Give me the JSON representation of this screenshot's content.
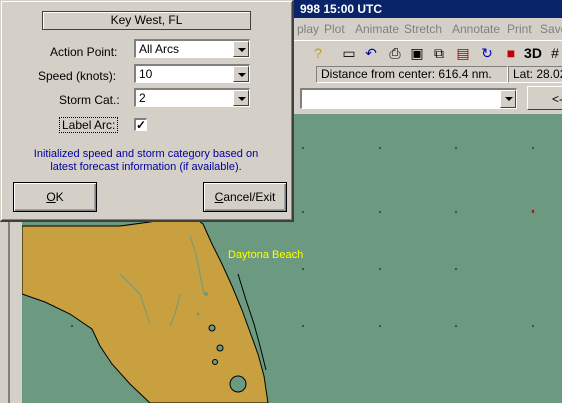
{
  "app": {
    "title_fragment": "998 15:00 UTC",
    "menus": [
      "play",
      "Plot",
      "Animate",
      "Stretch",
      "Annotate",
      "Print",
      "Save"
    ],
    "status": {
      "distance": "Distance from center: 616.4 nm.",
      "lat": "Lat: 28.02"
    },
    "nav_button": "<-",
    "map_label": "Daytona Beach",
    "colors": {
      "ocean": "#6b9a80",
      "land": "#c8a040",
      "label": "#ffff00",
      "titlebar": "#0a246a"
    }
  },
  "toolbar_icons": [
    "question-icon",
    "card-icon",
    "undo-icon",
    "printer-icon",
    "save-icon",
    "copy-icon",
    "note-icon",
    "refresh-icon",
    "stop-icon",
    "3d-icon",
    "hash-icon"
  ],
  "dialog": {
    "location": "Key West, FL",
    "fields": [
      {
        "label": "Action Point:",
        "value": "All Arcs"
      },
      {
        "label": "Speed (knots):",
        "value": "10"
      },
      {
        "label": "Storm Cat.:",
        "value": "2"
      }
    ],
    "label_arc": {
      "label": "Label Arc:",
      "checked": true,
      "mark": "✓"
    },
    "info": "Initialized speed and storm category based on latest forecast information (if available).",
    "ok_underlined": "O",
    "ok_rest": "K",
    "cancel_underlined": "C",
    "cancel_rest": "ancel/Exit"
  }
}
